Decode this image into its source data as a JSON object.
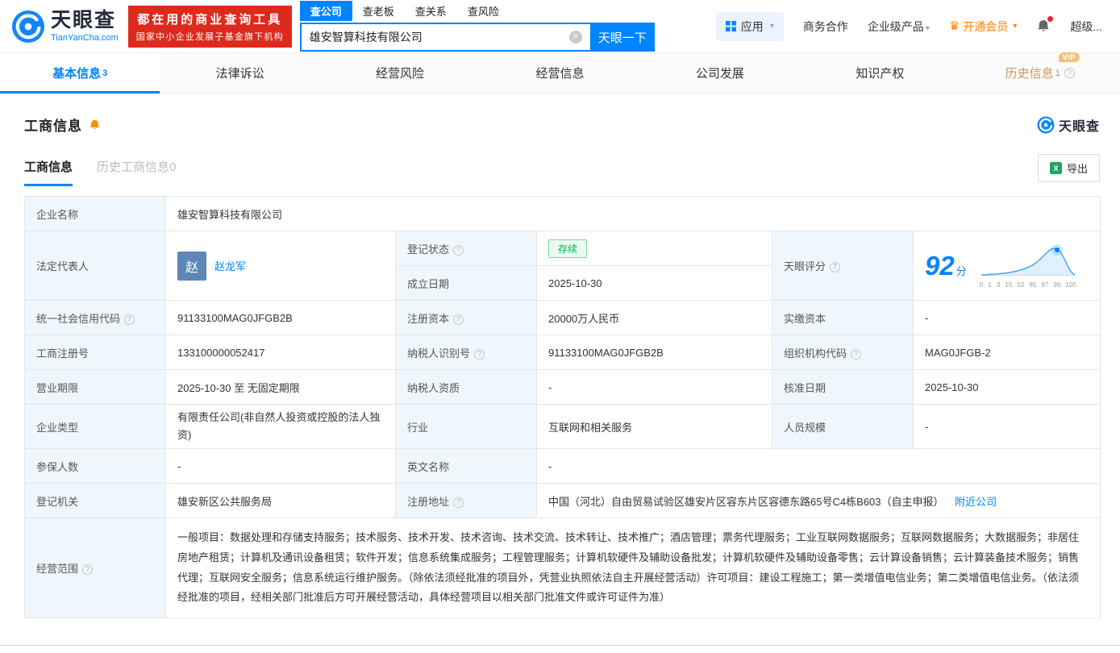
{
  "colors": {
    "primary_blue": "#0084ff",
    "banner_red": "#dd2a1c",
    "status_green": "#00b057",
    "vip_orange": "#ff8000",
    "history_gold": "#c49a62",
    "label_cell_bg": "#eff7fd"
  },
  "brand": {
    "name_cn": "天眼查",
    "name_en": "TianYanCha.com"
  },
  "banner": {
    "line1": "都在用的商业查询工具",
    "line2": "国家中小企业发展子基金旗下机构"
  },
  "search": {
    "tabs": [
      {
        "label": "查公司"
      },
      {
        "label": "查老板"
      },
      {
        "label": "查关系"
      },
      {
        "label": "查风险"
      }
    ],
    "value": "雄安智算科技有限公司",
    "button": "天眼一下"
  },
  "header_right": {
    "apps": "应用",
    "biz_coop": "商务合作",
    "enterprise": "企业级产品",
    "vip": "开通会员",
    "more": "超级..."
  },
  "nav_tabs": [
    {
      "label": "基本信息",
      "count": "3"
    },
    {
      "label": "法律诉讼"
    },
    {
      "label": "经营风险"
    },
    {
      "label": "经营信息"
    },
    {
      "label": "公司发展"
    },
    {
      "label": "知识产权"
    },
    {
      "label": "历史信息",
      "count": "1",
      "badge": "VIP"
    }
  ],
  "section": {
    "title": "工商信息",
    "subtabs": [
      {
        "label": "工商信息"
      },
      {
        "label": "历史工商信息0"
      }
    ],
    "export": "导出",
    "watermark": "天眼查"
  },
  "table": {
    "rows": {
      "company_name": {
        "label": "企业名称",
        "value": "雄安智算科技有限公司"
      },
      "legal_rep": {
        "label": "法定代表人",
        "avatar": "赵",
        "name": "赵龙军"
      },
      "reg_status": {
        "label": "登记状态",
        "value": "存续"
      },
      "establish_date": {
        "label": "成立日期",
        "value": "2025-10-30"
      },
      "score": {
        "label": "天眼评分",
        "value": "92",
        "unit": "分",
        "axis": [
          "0",
          "1",
          "3",
          "15",
          "50",
          "85",
          "97",
          "99",
          "100"
        ]
      },
      "credit_code": {
        "label": "统一社会信用代码",
        "value": "91133100MAG0JFGB2B"
      },
      "reg_capital": {
        "label": "注册资本",
        "value": "20000万人民币"
      },
      "paid_capital": {
        "label": "实缴资本",
        "value": "-"
      },
      "reg_no": {
        "label": "工商注册号",
        "value": "133100000052417"
      },
      "taxpayer_no": {
        "label": "纳税人识别号",
        "value": "91133100MAG0JFGB2B"
      },
      "org_code": {
        "label": "组织机构代码",
        "value": "MAG0JFGB-2"
      },
      "term": {
        "label": "营业期限",
        "value": "2025-10-30 至 无固定期限"
      },
      "taxpayer_quali": {
        "label": "纳税人资质",
        "value": "-"
      },
      "approve_date": {
        "label": "核准日期",
        "value": "2025-10-30"
      },
      "company_type": {
        "label": "企业类型",
        "value": "有限责任公司(非自然人投资或控股的法人独资)"
      },
      "industry": {
        "label": "行业",
        "value": "互联网和相关服务"
      },
      "staff": {
        "label": "人员规模",
        "value": "-"
      },
      "insured": {
        "label": "参保人数",
        "value": "-"
      },
      "en_name": {
        "label": "英文名称",
        "value": "-"
      },
      "authority": {
        "label": "登记机关",
        "value": "雄安新区公共服务局"
      },
      "address": {
        "label": "注册地址",
        "value": "中国（河北）自由贸易试验区雄安片区容东片区容德东路65号C4栋B603（自主申报）",
        "link": "附近公司"
      },
      "scope": {
        "label": "经营范围",
        "value": "一般项目：数据处理和存储支持服务；技术服务、技术开发、技术咨询、技术交流、技术转让、技术推广；酒店管理；票务代理服务；工业互联网数据服务；互联网数据服务；大数据服务；非居住房地产租赁；计算机及通讯设备租赁；软件开发；信息系统集成服务；工程管理服务；计算机软硬件及辅助设备批发；计算机软硬件及辅助设备零售；云计算设备销售；云计算装备技术服务；销售代理；互联网安全服务；信息系统运行维护服务。（除依法须经批准的项目外，凭营业执照依法自主开展经营活动）许可项目：建设工程施工；第一类增值电信业务；第二类增值电信业务。（依法须经批准的项目，经相关部门批准后方可开展经营活动，具体经营项目以相关部门批准文件或许可证件为准）"
      }
    }
  }
}
